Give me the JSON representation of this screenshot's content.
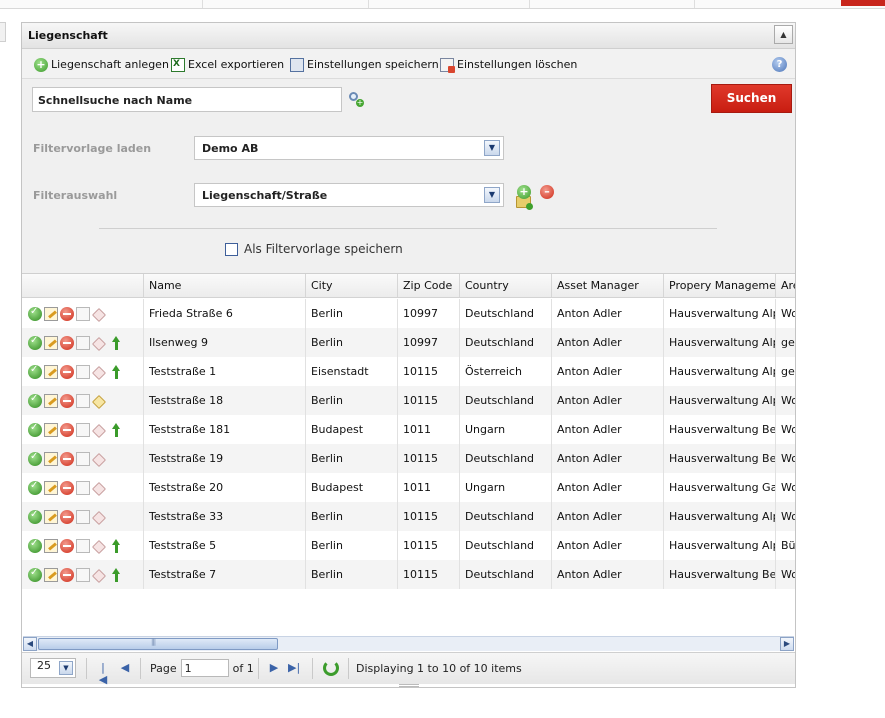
{
  "panel": {
    "title": "Liegenschaft",
    "collapse_glyph": "▲"
  },
  "toolbar": {
    "create_label": "Liegenschaft anlegen",
    "excel_label": "Excel exportieren",
    "save_settings_label": "Einstellungen speichern",
    "delete_settings_label": "Einstellungen löschen",
    "help_glyph": "?"
  },
  "search": {
    "value": "Schnellsuche nach Name",
    "button_label": "Suchen"
  },
  "filters": {
    "template_label": "Filtervorlage laden",
    "template_value": "Demo AB",
    "selection_label": "Filterauswahl",
    "selection_value": "Liegenschaft/Straße",
    "save_as_template_label": "Als Filtervorlage speichern",
    "dropdown_glyph": "▼",
    "add_glyph": "+",
    "remove_glyph": "–"
  },
  "grid": {
    "columns": [
      "",
      "Name",
      "City",
      "Zip Code",
      "Country",
      "Asset Manager",
      "Propery Management",
      "Area"
    ],
    "rows": [
      {
        "name": "Frieda Straße 6",
        "city": "Berlin",
        "zip": "10997",
        "country": "Deutschland",
        "asset_manager": "Anton Adler",
        "management": "Hausverwaltung Alph",
        "area": "Wo",
        "up": false,
        "tag": "red"
      },
      {
        "name": "Ilsenweg 9",
        "city": "Berlin",
        "zip": "10997",
        "country": "Deutschland",
        "asset_manager": "Anton Adler",
        "management": "Hausverwaltung Alph",
        "area": "ge",
        "up": true,
        "tag": "red"
      },
      {
        "name": "Teststraße 1",
        "city": "Eisenstadt",
        "zip": "10115",
        "country": "Österreich",
        "asset_manager": "Anton Adler",
        "management": "Hausverwaltung Alph",
        "area": "ge",
        "up": true,
        "tag": "red"
      },
      {
        "name": "Teststraße 18",
        "city": "Berlin",
        "zip": "10115",
        "country": "Deutschland",
        "asset_manager": "Anton Adler",
        "management": "Hausverwaltung Alph",
        "area": "Wo",
        "up": false,
        "tag": "yellow"
      },
      {
        "name": "Teststraße 181",
        "city": "Budapest",
        "zip": "1011",
        "country": "Ungarn",
        "asset_manager": "Anton Adler",
        "management": "Hausverwaltung Beta",
        "area": "Wo",
        "up": true,
        "tag": "red"
      },
      {
        "name": "Teststraße 19",
        "city": "Berlin",
        "zip": "10115",
        "country": "Deutschland",
        "asset_manager": "Anton Adler",
        "management": "Hausverwaltung Beta",
        "area": "Wo",
        "up": false,
        "tag": "red"
      },
      {
        "name": "Teststraße 20",
        "city": "Budapest",
        "zip": "1011",
        "country": "Ungarn",
        "asset_manager": "Anton Adler",
        "management": "Hausverwaltung Gam",
        "area": "Wo",
        "up": false,
        "tag": "red"
      },
      {
        "name": "Teststraße 33",
        "city": "Berlin",
        "zip": "10115",
        "country": "Deutschland",
        "asset_manager": "Anton Adler",
        "management": "Hausverwaltung Alph",
        "area": "Wo",
        "up": false,
        "tag": "red"
      },
      {
        "name": "Teststraße 5",
        "city": "Berlin",
        "zip": "10115",
        "country": "Deutschland",
        "asset_manager": "Anton Adler",
        "management": "Hausverwaltung Alph",
        "area": "Bü",
        "up": true,
        "tag": "red"
      },
      {
        "name": "Teststraße 7",
        "city": "Berlin",
        "zip": "10115",
        "country": "Deutschland",
        "asset_manager": "Anton Adler",
        "management": "Hausverwaltung Beta",
        "area": "Wo",
        "up": true,
        "tag": "red"
      }
    ]
  },
  "pager": {
    "page_size": "25",
    "page_label": "Page",
    "page_value": "1",
    "of_label": "of 1",
    "status": "Displaying 1 to 10 of 10 items",
    "first_glyph": "|◀",
    "prev_glyph": "◀",
    "next_glyph": "▶",
    "last_glyph": "▶|",
    "scroll_left_glyph": "◀",
    "scroll_right_glyph": "▶"
  },
  "colors": {
    "search_button": "#d42a1d",
    "top_accent": "#c8251b",
    "row_alt": "#f4f4f4"
  }
}
